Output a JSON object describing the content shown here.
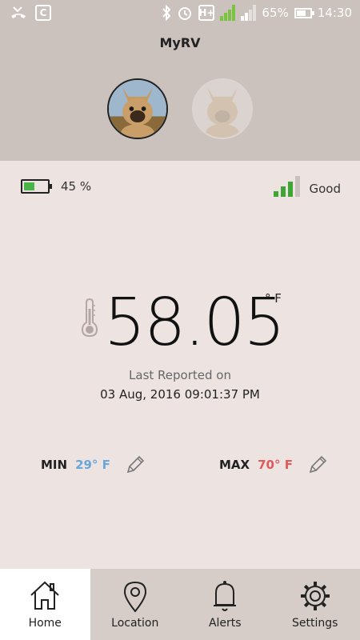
{
  "status_bar": {
    "battery_percent": "65%",
    "time": "14:30",
    "network_label": "H+",
    "sim_label": "2"
  },
  "header": {
    "title": "MyRV",
    "avatars": [
      {
        "name": "dog-avatar-selected"
      },
      {
        "name": "dog-avatar-faded"
      }
    ]
  },
  "device": {
    "battery_text": "45 %",
    "battery_level": 0.45,
    "signal_text": "Good",
    "signal_bars_active": 3,
    "signal_bars_total": 4
  },
  "temperature": {
    "value": "58.05",
    "unit": "° F",
    "last_reported_label": "Last Reported on",
    "last_reported_date": "03 Aug, 2016 09:01:37 PM"
  },
  "limits": {
    "min_label": "MIN",
    "min_value": "29° F",
    "max_label": "MAX",
    "max_value": "70° F"
  },
  "nav": {
    "home": "Home",
    "location": "Location",
    "alerts": "Alerts",
    "settings": "Settings"
  },
  "colors": {
    "min_color": "#6aa6d8",
    "max_color": "#e05a5a",
    "battery_green": "#49b548",
    "signal_green": "#3fa535",
    "signal_inactive": "#c8c2bf"
  }
}
